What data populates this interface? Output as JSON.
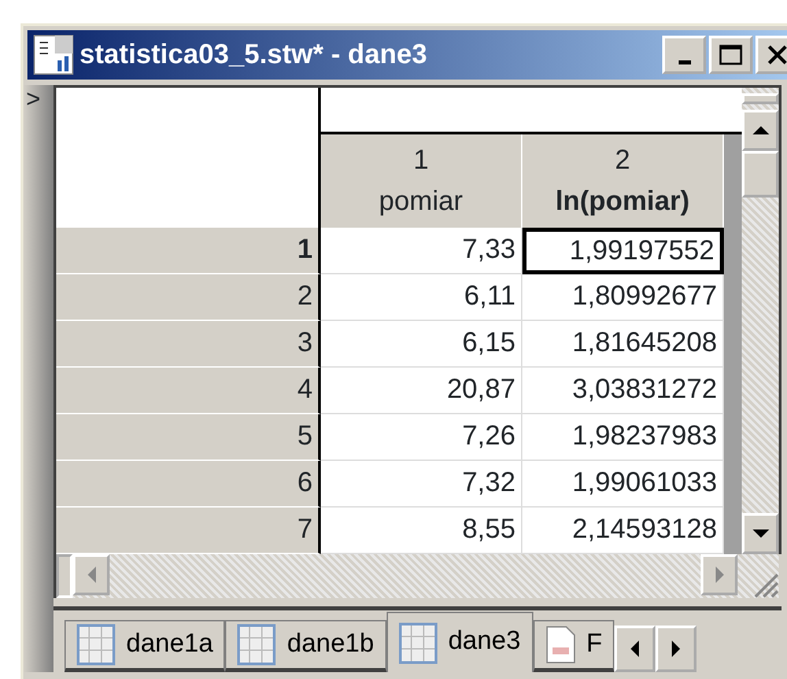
{
  "window": {
    "title": "statistica03_5.stw* - dane3"
  },
  "row_marker": ">",
  "table": {
    "columns": [
      {
        "number": "1",
        "name": "pomiar"
      },
      {
        "number": "2",
        "name": "ln(pomiar)"
      }
    ],
    "rows": [
      {
        "label": "1",
        "cells": [
          "7,33",
          "1,99197552"
        ],
        "selected": true
      },
      {
        "label": "2",
        "cells": [
          "6,11",
          "1,80992677"
        ],
        "selected": false
      },
      {
        "label": "3",
        "cells": [
          "6,15",
          "1,81645208"
        ],
        "selected": false
      },
      {
        "label": "4",
        "cells": [
          "20,87",
          "3,03831272"
        ],
        "selected": false
      },
      {
        "label": "5",
        "cells": [
          "7,26",
          "1,98237983"
        ],
        "selected": false
      },
      {
        "label": "6",
        "cells": [
          "7,32",
          "1,99061033"
        ],
        "selected": false
      },
      {
        "label": "7",
        "cells": [
          "8,55",
          "2,14593128"
        ],
        "selected": false
      }
    ]
  },
  "tabs": [
    {
      "label": "dane1a",
      "kind": "sheet",
      "selected": false
    },
    {
      "label": "dane1b",
      "kind": "sheet",
      "selected": false
    },
    {
      "label": "dane3",
      "kind": "sheet",
      "selected": true
    },
    {
      "label": "F",
      "kind": "report",
      "selected": false
    }
  ]
}
